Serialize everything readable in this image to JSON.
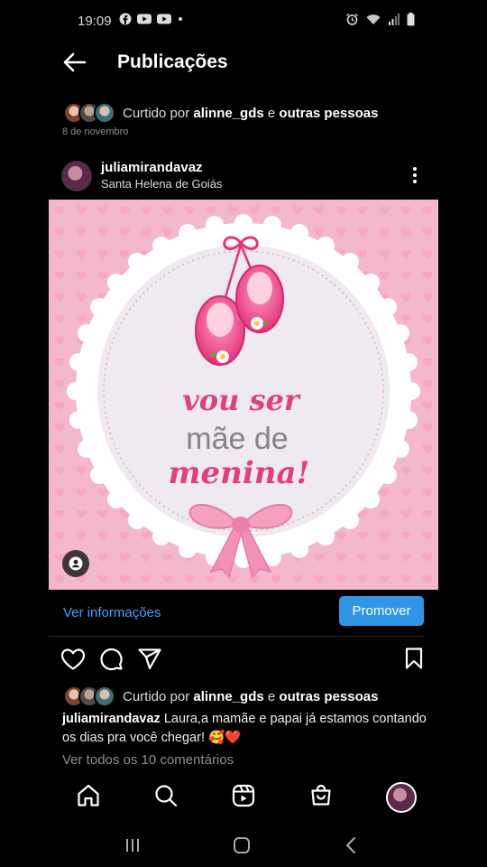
{
  "status_bar": {
    "time": "19:09"
  },
  "header": {
    "title": "Publicações"
  },
  "liked_top": {
    "prefix": "Curtido por ",
    "user": "alinne_gds",
    "conj": " e ",
    "others": "outras pessoas"
  },
  "date": "8 de novembro",
  "post": {
    "username": "juliamirandavaz",
    "location": "Santa Helena de Goiás",
    "image_text": {
      "line1": "vou ser",
      "line2": "mãe de",
      "line3": "menina!"
    },
    "ver_info": "Ver informações",
    "promote": "Promover",
    "liked": {
      "prefix": "Curtido por ",
      "user": "alinne_gds",
      "conj": " e ",
      "others": "outras pessoas"
    },
    "caption": {
      "user": "juliamirandavaz",
      "text": " Laura,a mamãe e papai já estamos contando os dias pra você chegar! 🥰❤️"
    },
    "comments_link": "Ver todos os 10 comentários"
  },
  "colors": {
    "accent": "#2f95e6",
    "link": "#4a9eff",
    "pink_bg": "#f2b7cd",
    "pink_text": "#e0407e",
    "background": "#000000"
  }
}
